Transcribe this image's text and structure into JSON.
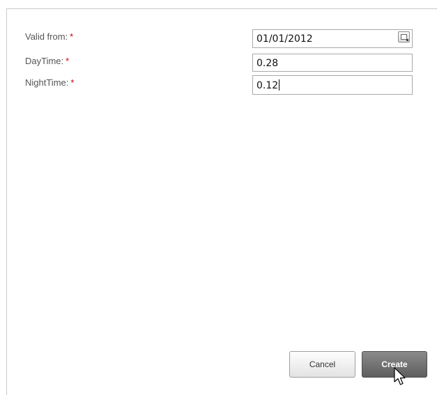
{
  "form": {
    "fields": [
      {
        "label": "Valid from:",
        "required_mark": "*",
        "value": "01/01/2012",
        "icon": "calendar-icon"
      },
      {
        "label": "DayTime:",
        "required_mark": "*",
        "value": "0.28"
      },
      {
        "label": "NightTime:",
        "required_mark": "*",
        "value": "0.12"
      }
    ]
  },
  "actions": {
    "cancel_label": "Cancel",
    "create_label": "Create"
  },
  "colors": {
    "required": "#d00000",
    "primary_button": "#6e6e6e",
    "border": "#a9a9a9"
  }
}
